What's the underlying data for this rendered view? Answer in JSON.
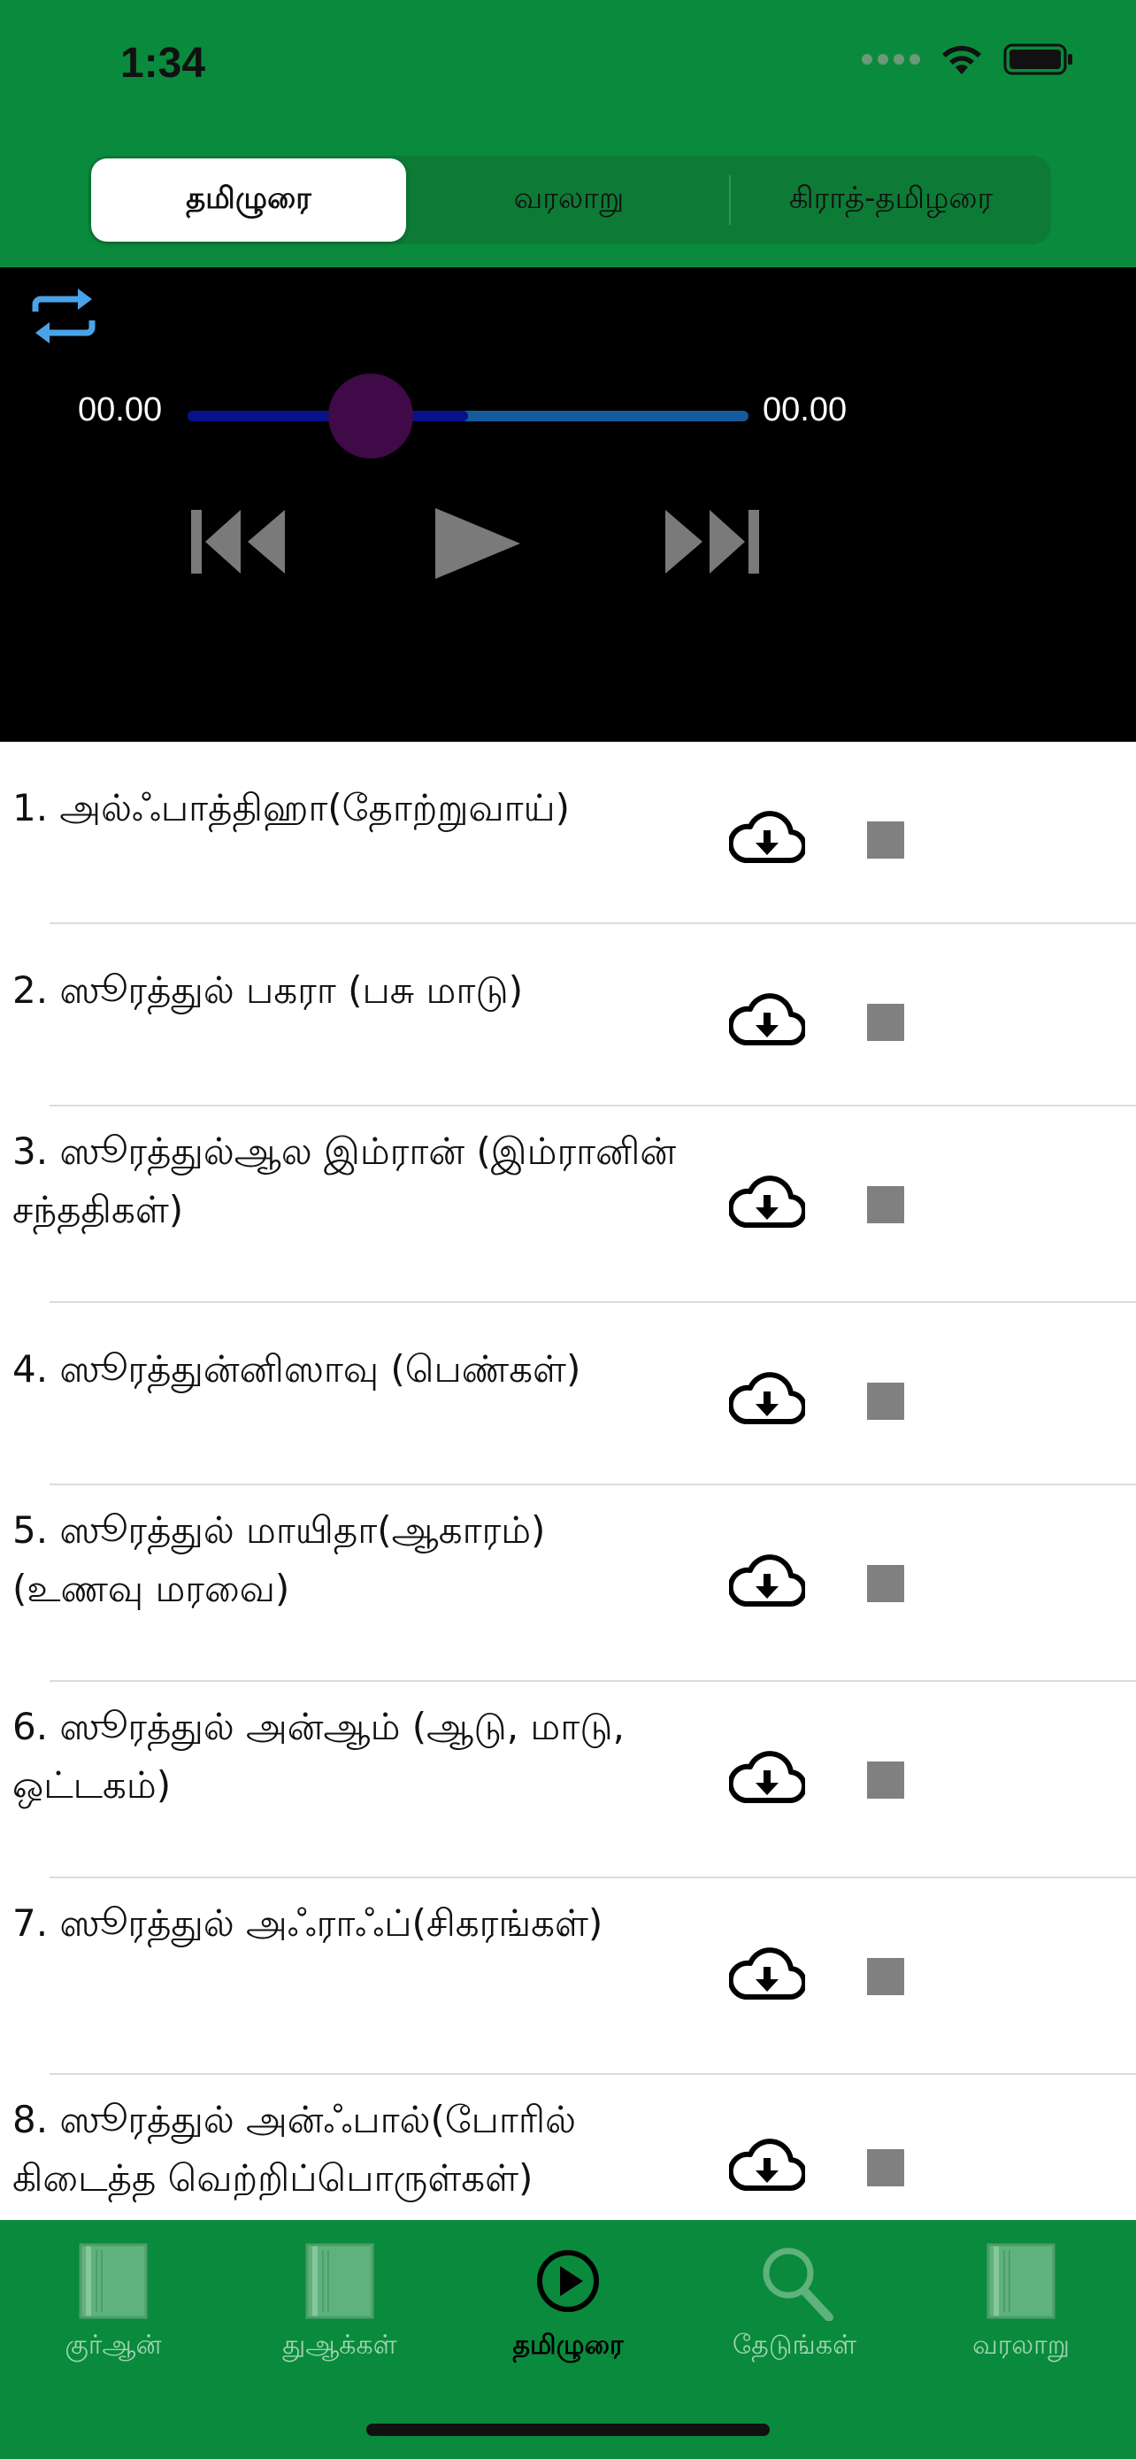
{
  "status": {
    "time": "1:34"
  },
  "segments": [
    {
      "label": "தமிழுரை",
      "active": true
    },
    {
      "label": "வரலாறு",
      "active": false
    },
    {
      "label": "கிராத்-தமிழரை",
      "active": false
    }
  ],
  "player": {
    "elapsed": "00.00",
    "total": "00.00",
    "progress": 0.5
  },
  "surahs": [
    {
      "title": "1. அல்ஃபாத்திஹா(தோற்றுவாய்)"
    },
    {
      "title": "2. ஸூரத்துல் பகரா (பசு மாடு)"
    },
    {
      "title": "3. ஸூரத்துல்ஆல இம்ரான் (இம்ரானின் சந்ததிகள்)"
    },
    {
      "title": "4. ஸூரத்துன்னிஸாவு (பெண்கள்)"
    },
    {
      "title": "5. ஸூரத்துல் மாயிதா(ஆகாரம்) (உணவு மரவை)"
    },
    {
      "title": "6. ஸூரத்துல் அன்ஆம் (ஆடு, மாடு, ஒட்டகம்)"
    },
    {
      "title": "7. ஸூரத்துல் அஃராஃப்(சிகரங்கள்)"
    },
    {
      "title": "8. ஸூரத்துல் அன்ஃபால்(போரில் கிடைத்த வெற்றிப்பொருள்கள்)"
    }
  ],
  "tabs": [
    {
      "label": "குர்ஆன்",
      "icon": "book-icon",
      "active": false
    },
    {
      "label": "துஆக்கள்",
      "icon": "book-icon",
      "active": false
    },
    {
      "label": "தமிழுரை",
      "icon": "play-circle-icon",
      "active": true
    },
    {
      "label": "தேடுங்கள்",
      "icon": "search-icon",
      "active": false
    },
    {
      "label": "வரலாறு",
      "icon": "book-icon",
      "active": false
    }
  ],
  "colors": {
    "header_green": "#0a8a3c",
    "player_bg": "#000000",
    "slider_track": "#155b9b",
    "slider_fill": "#06118a",
    "slider_thumb": "#3f0a47",
    "repeat_icon": "#4aa3e8"
  }
}
